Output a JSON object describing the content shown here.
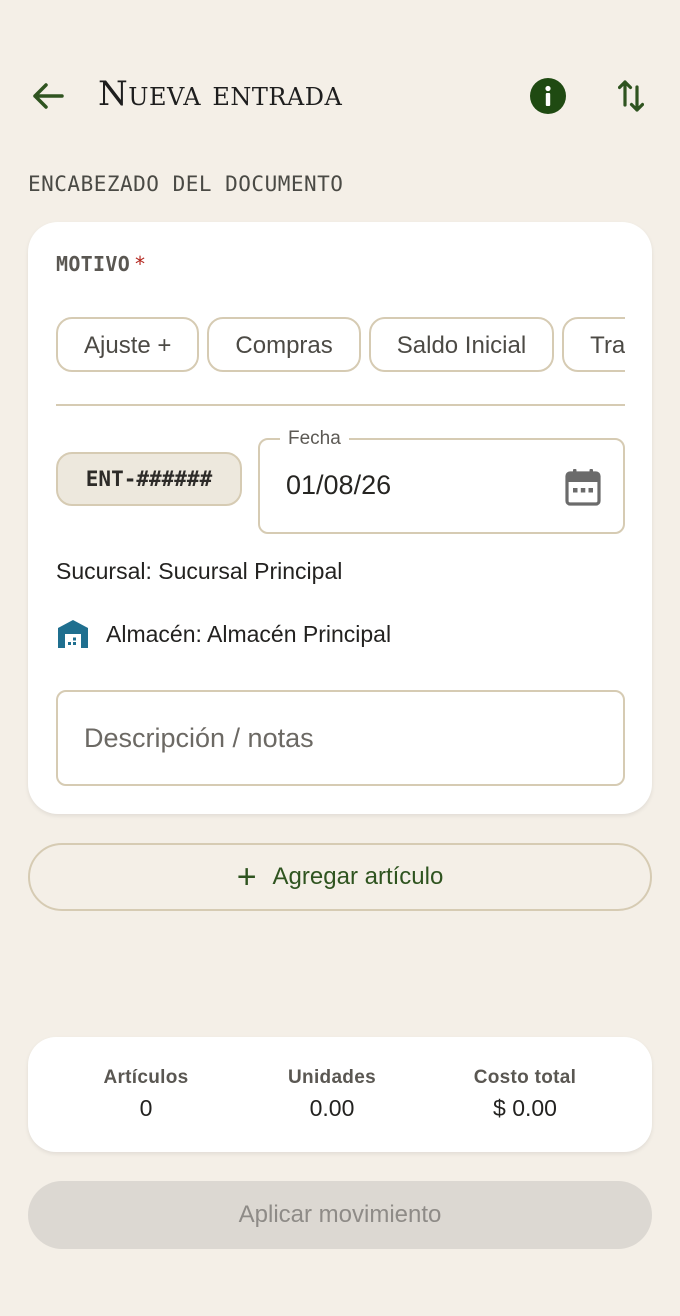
{
  "appbar": {
    "title": "Nueva entrada",
    "back_icon": "arrow-back-icon",
    "info_icon": "info-icon",
    "sort_icon": "swap-vertical-icon"
  },
  "section": {
    "title": "ENCABEZADO DEL DOCUMENTO"
  },
  "form": {
    "motivo_label": "MOTIVO",
    "required_mark": "*",
    "chips": [
      "Ajuste +",
      "Compras",
      "Saldo Inicial",
      "Traspaso"
    ],
    "doc_number": "ENT-######",
    "date_label": "Fecha",
    "date_value": "01/08/26",
    "sucursal": "Sucursal: Sucursal Principal",
    "almacen": "Almacén: Almacén Principal",
    "description_placeholder": "Descripción / notas"
  },
  "actions": {
    "add_item_label": "Agregar artículo",
    "apply_label": "Aplicar movimiento"
  },
  "summary": {
    "items_label": "Artículos",
    "items_value": "0",
    "units_label": "Unidades",
    "units_value": "0.00",
    "cost_label": "Costo total",
    "cost_value": "$ 0.00"
  },
  "colors": {
    "background": "#f4efe7",
    "accent_green": "#2f5420",
    "outline": "#d6cbb3",
    "warehouse_icon": "#1f6f8f",
    "required": "#b3261e"
  }
}
